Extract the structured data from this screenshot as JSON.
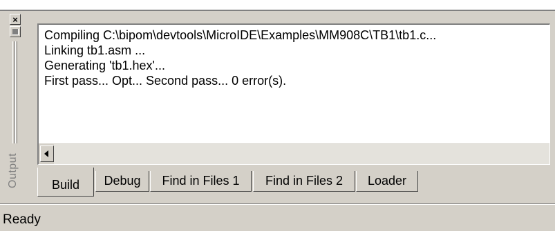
{
  "window": {
    "close_glyph": "×",
    "panel_title": "Output"
  },
  "output": {
    "lines": [
      "Compiling C:\\bipom\\devtools\\MicroIDE\\Examples\\MM908C\\TB1\\tb1.c...",
      "Linking tb1.asm ...",
      "Generating 'tb1.hex'...",
      "First pass... Opt... Second pass... 0 error(s)."
    ]
  },
  "tabs": [
    {
      "label": "Build",
      "active": true
    },
    {
      "label": "Debug",
      "active": false
    },
    {
      "label": "Find in Files 1",
      "active": false
    },
    {
      "label": "Find in Files 2",
      "active": false
    },
    {
      "label": "Loader",
      "active": false
    }
  ],
  "status": {
    "text": "Ready"
  },
  "icons": {
    "close": "close-icon",
    "float": "float-icon",
    "scroll_left": "arrow-left-icon"
  },
  "colors": {
    "face": "#d4d0c8",
    "shadow": "#808080",
    "highlight": "#ffffff",
    "text": "#000000"
  }
}
